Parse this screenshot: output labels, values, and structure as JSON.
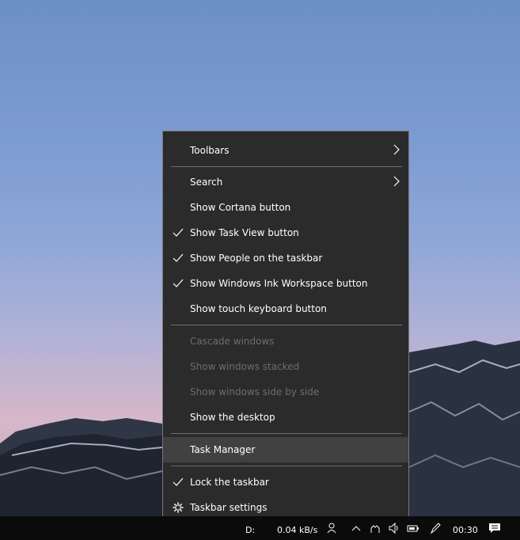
{
  "context_menu": {
    "items": [
      {
        "label": "Toolbars",
        "submenu": true
      },
      {
        "label": "Search",
        "submenu": true
      },
      {
        "label": "Show Cortana button"
      },
      {
        "label": "Show Task View button",
        "checked": true
      },
      {
        "label": "Show People on the taskbar",
        "checked": true
      },
      {
        "label": "Show Windows Ink Workspace button",
        "checked": true
      },
      {
        "label": "Show touch keyboard button"
      },
      {
        "label": "Cascade windows",
        "disabled": true
      },
      {
        "label": "Show windows stacked",
        "disabled": true
      },
      {
        "label": "Show windows side by side",
        "disabled": true
      },
      {
        "label": "Show the desktop"
      },
      {
        "label": "Task Manager",
        "highlighted": true
      },
      {
        "label": "Lock the taskbar",
        "checked": true
      },
      {
        "label": "Taskbar settings",
        "icon": "gear-icon"
      }
    ]
  },
  "taskbar": {
    "drive_label": "D:",
    "net_speed": "0.04 kB/s",
    "clock": "00:30",
    "tray_icons": [
      "people-icon",
      "chevron-up-icon",
      "touch-keyboard-icon",
      "volume-icon",
      "battery-icon",
      "ink-pen-icon",
      "action-center-icon"
    ]
  },
  "colors": {
    "menu_bg": "#2b2b2b",
    "menu_highlight": "#414141",
    "disabled_text": "#6d6d6d",
    "taskbar_bg": "#0b0b0b"
  }
}
